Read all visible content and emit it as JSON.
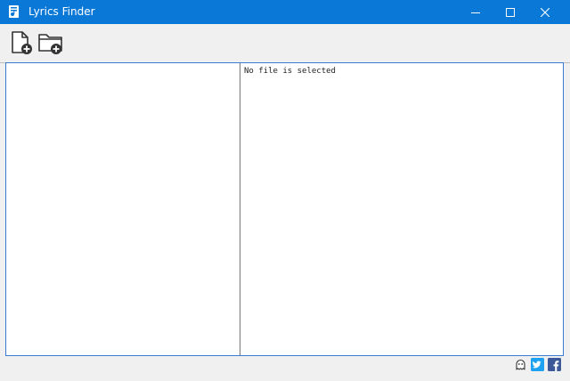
{
  "window": {
    "title": "Lyrics Finder",
    "accent_color": "#0a78d7"
  },
  "toolbar": {
    "add_file_icon": "add-file-icon",
    "add_folder_icon": "add-folder-icon"
  },
  "right_pane": {
    "message": "No file is selected"
  },
  "statusbar": {
    "icons": [
      "ghost-icon",
      "twitter-icon",
      "facebook-icon"
    ],
    "twitter_color": "#1da1f2",
    "facebook_color": "#3b5998"
  }
}
